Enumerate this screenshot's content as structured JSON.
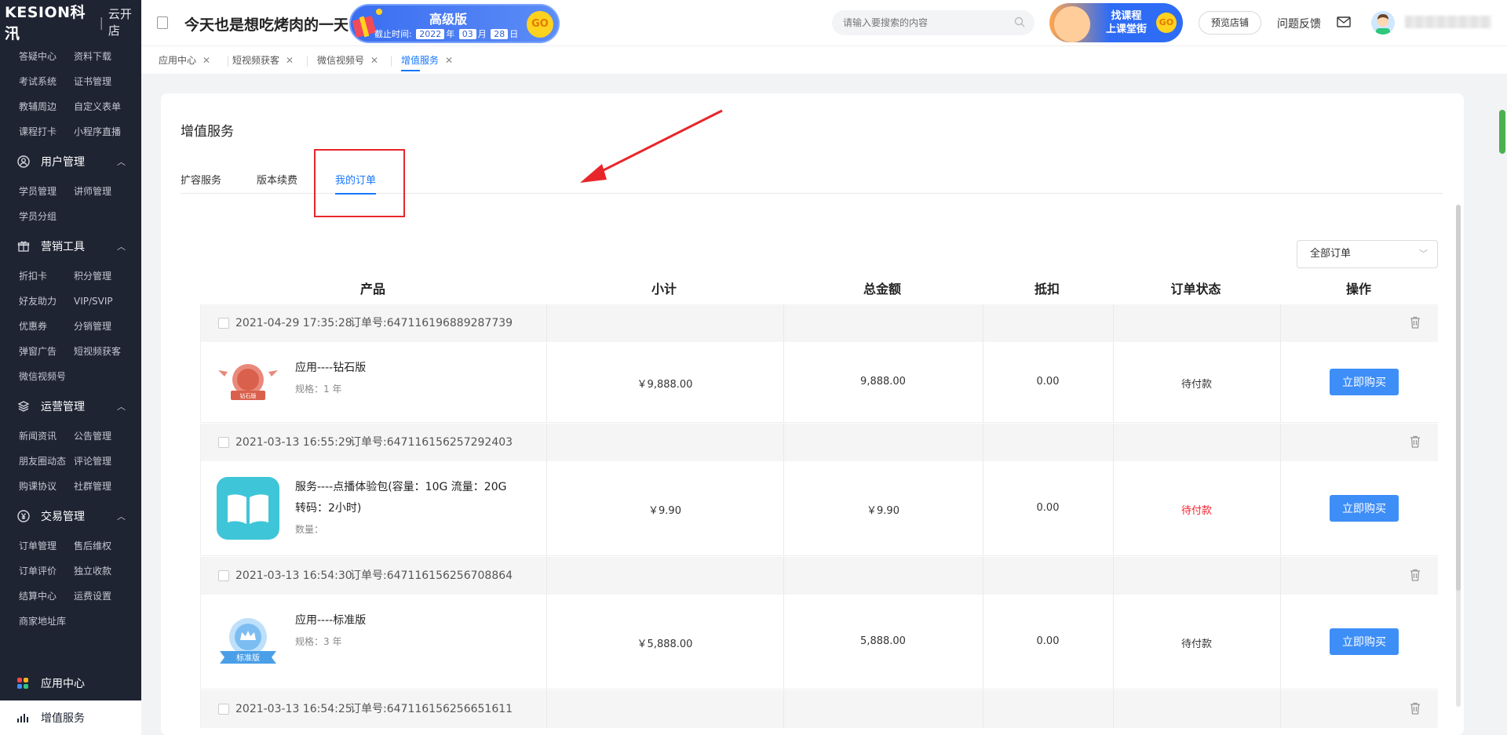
{
  "sidebar": {
    "brand": "KESION科汛",
    "brand_sub": "云开店",
    "top_items": [
      "答疑中心",
      "资料下载",
      "考试系统",
      "证书管理",
      "教辅周边",
      "自定义表单",
      "课程打卡",
      "小程序直播"
    ],
    "sections": [
      {
        "title": "用户管理",
        "icon": "user-icon",
        "items": [
          "学员管理",
          "讲师管理",
          "学员分组"
        ]
      },
      {
        "title": "营销工具",
        "icon": "gift-icon",
        "items": [
          "折扣卡",
          "积分管理",
          "好友助力",
          "VIP/SVIP",
          "优惠券",
          "分销管理",
          "弹窗广告",
          "短视频获客",
          "微信视频号"
        ]
      },
      {
        "title": "运营管理",
        "icon": "layers-icon",
        "items": [
          "新闻资讯",
          "公告管理",
          "朋友圈动态",
          "评论管理",
          "购课协议",
          "社群管理"
        ]
      },
      {
        "title": "交易管理",
        "icon": "yen-icon",
        "items": [
          "订单管理",
          "售后维权",
          "订单评价",
          "独立收款",
          "结算中心",
          "运费设置",
          "商家地址库"
        ]
      }
    ],
    "bottom_items": [
      {
        "label": "应用中心",
        "icon": "apps-icon",
        "active": false
      },
      {
        "label": "增值服务",
        "icon": "chart-icon",
        "active": true
      }
    ]
  },
  "header": {
    "store_name": "今天也是想吃烤肉的一天",
    "vip": {
      "title": "高级版",
      "deadline_label": "截止时间:",
      "year": "2022",
      "year_unit": "年",
      "month": "03",
      "month_unit": "月",
      "day": "28",
      "day_unit": "日",
      "go": "GO"
    },
    "search_placeholder": "请输入要搜索的内容",
    "promo": {
      "line1": "找课程",
      "line2": "上课堂街",
      "go": "GO"
    },
    "preview_label": "预览店铺",
    "feedback_label": "问题反馈"
  },
  "page_tabs": [
    {
      "label": "应用中心",
      "active": false
    },
    {
      "label": "短视频获客",
      "active": false
    },
    {
      "label": "微信视频号",
      "active": false
    },
    {
      "label": "增值服务",
      "active": true
    }
  ],
  "content": {
    "title": "增值服务",
    "sub_tabs": [
      {
        "label": "扩容服务",
        "active": false
      },
      {
        "label": "版本续费",
        "active": false
      },
      {
        "label": "我的订单",
        "active": true
      }
    ],
    "filter_label": "全部订单",
    "columns": [
      "产品",
      "小计",
      "总金额",
      "抵扣",
      "订单状态",
      "操作"
    ],
    "orders": [
      {
        "datetime": "2021-04-29 17:35:28",
        "order_no_label": "订单号:",
        "order_no": "647116196889287739",
        "product": "应用----钻石版",
        "spec": "规格：1 年",
        "badge": "钻石版",
        "subtotal": "￥9,888.00",
        "total": "9,888.00",
        "deduct": "0.00",
        "status": "待付款",
        "status_color": "#333333",
        "action": "立即购买"
      },
      {
        "datetime": "2021-03-13 16:55:29",
        "order_no_label": "订单号:",
        "order_no": "647116156257292403",
        "product": "服务----点播体验包(容量：10G 流量：20G 转码：2小时)",
        "spec": "数量：",
        "badge": "",
        "subtotal": "￥9.90",
        "total": "￥9.90",
        "deduct": "0.00",
        "status": "待付款",
        "status_color": "#f5222d",
        "action": "立即购买"
      },
      {
        "datetime": "2021-03-13 16:54:30",
        "order_no_label": "订单号:",
        "order_no": "647116156256708864",
        "product": "应用----标准版",
        "spec": "规格：3 年",
        "badge": "标准版",
        "subtotal": "￥5,888.00",
        "total": "5,888.00",
        "deduct": "0.00",
        "status": "待付款",
        "status_color": "#333333",
        "action": "立即购买"
      },
      {
        "datetime": "2021-03-13 16:54:25",
        "order_no_label": "订单号:",
        "order_no": "647116156256651611"
      }
    ]
  },
  "colors": {
    "sidebar_bg": "#1f2433",
    "accent": "#1677ff",
    "button": "#3e8ef7",
    "annotation": "#e8262a"
  }
}
